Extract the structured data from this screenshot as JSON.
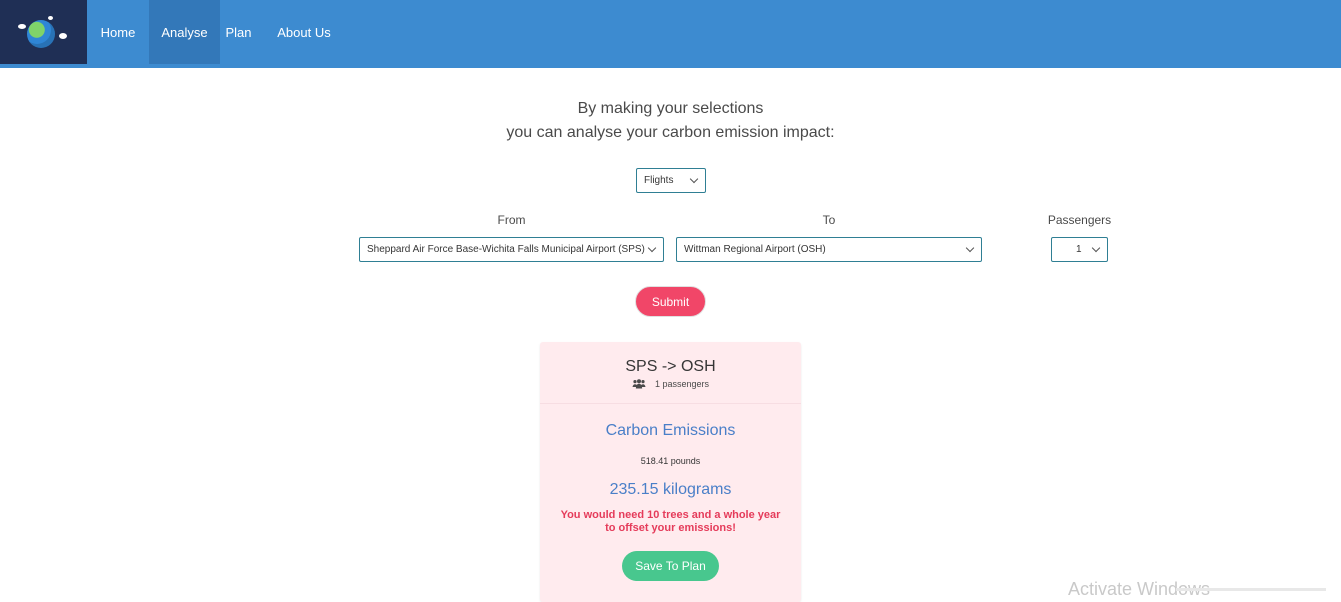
{
  "nav": {
    "items": [
      {
        "label": "Home"
      },
      {
        "label": "Analyse",
        "active": true
      },
      {
        "label": "Plan"
      },
      {
        "label": "About Us"
      }
    ],
    "logo_icon": "earth-logo-icon",
    "background_color": "#3d8bd0",
    "active_color": "#3378b9"
  },
  "intro": {
    "line1": "By making your selections",
    "line2": "you can analyse your carbon emission impact:"
  },
  "mode_select": {
    "value": "Flights"
  },
  "from": {
    "label": "From",
    "value": "Sheppard Air Force Base-Wichita Falls Municipal Airport (SPS)"
  },
  "to": {
    "label": "To",
    "value": "Wittman Regional Airport (OSH)"
  },
  "passengers": {
    "label": "Passengers",
    "value": "1"
  },
  "submit": {
    "label": "Submit",
    "color": "#f14668"
  },
  "result": {
    "route": "SPS -> OSH",
    "passengers_text": "1 passengers",
    "title": "Carbon Emissions",
    "pounds": "518.41 pounds",
    "kilograms": "235.15 kilograms",
    "warning_line1": "You would need 10 trees and a whole year",
    "warning_line2": "to offset your emissions!",
    "save_label": "Save To Plan",
    "card_color": "#ffebee",
    "accent_color": "#4a7fc8",
    "save_color": "#48c78e"
  },
  "watermark": {
    "text": "Activate Windows"
  }
}
